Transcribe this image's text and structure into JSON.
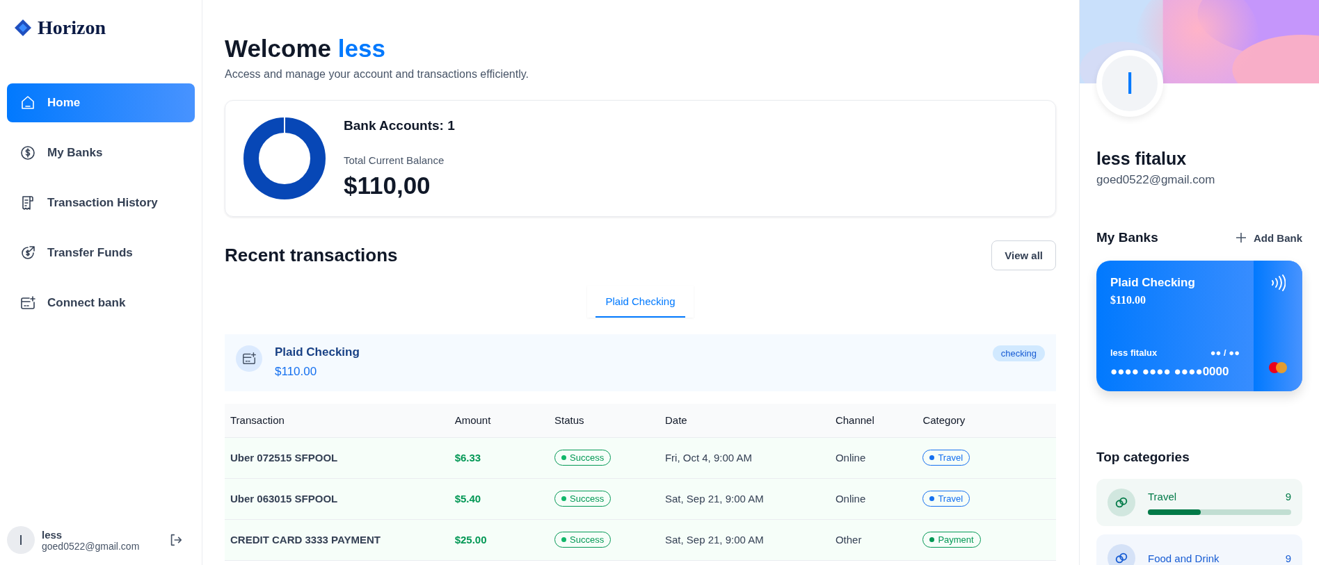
{
  "sidebar": {
    "logo": "Horizon",
    "items": [
      {
        "label": "Home",
        "kind": "home",
        "selected": true
      },
      {
        "label": "My Banks",
        "kind": "dollar",
        "selected": false
      },
      {
        "label": "Transaction History",
        "kind": "receipt",
        "selected": false
      },
      {
        "label": "Transfer Funds",
        "kind": "transfer",
        "selected": false
      },
      {
        "label": "Connect bank",
        "kind": "connect",
        "selected": false
      }
    ],
    "user": {
      "initial": "I",
      "name": "less",
      "email": "goed0522@gmail.com"
    }
  },
  "header": {
    "greeting": "Welcome",
    "name": "less",
    "subtitle": "Access and manage your account and transactions efficiently."
  },
  "balance": {
    "accounts": "Bank Accounts: 1",
    "label": "Total Current Balance",
    "amount": "$110,00"
  },
  "recent": {
    "title": "Recent transactions",
    "view_all": "View all",
    "tabs": [
      {
        "label": "Plaid Checking",
        "selected": true
      }
    ],
    "account": {
      "name": "Plaid Checking",
      "amount": "$110.00",
      "type": "checking"
    },
    "columns": [
      "Transaction",
      "Amount",
      "Status",
      "Date",
      "Channel",
      "Category"
    ],
    "rows": [
      {
        "name": "Uber 072515 SFPOOL",
        "amount": "$6.33",
        "status": "Success",
        "date": "Fri, Oct 4, 9:00 AM",
        "channel": "Online",
        "category": "Travel",
        "color": "#1570ef"
      },
      {
        "name": "Uber 063015 SFPOOL",
        "amount": "$5.40",
        "status": "Success",
        "date": "Sat, Sep 21, 9:00 AM",
        "channel": "Online",
        "category": "Travel",
        "color": "#1570ef"
      },
      {
        "name": "CREDIT CARD 3333 PAYMENT",
        "amount": "$25.00",
        "status": "Success",
        "date": "Sat, Sep 21, 9:00 AM",
        "channel": "Other",
        "category": "Payment",
        "color": "#039855"
      }
    ]
  },
  "profile": {
    "initial": "I",
    "name": "less fitalux",
    "email": "goed0522@gmail.com"
  },
  "banks": {
    "title": "My Banks",
    "add": "Add Bank",
    "card": {
      "name": "Plaid Checking",
      "balance": "$110.00",
      "holder": "less fitalux",
      "expiry": "●● / ●●",
      "number": "●●●● ●●●● ●●●●0000"
    }
  },
  "categories": {
    "title": "Top categories",
    "items": [
      {
        "name": "Travel",
        "count": "9",
        "level": 0.37,
        "color": "#027a48"
      },
      {
        "name": "Food and Drink",
        "count": "9",
        "color": "#175cd3"
      }
    ]
  }
}
